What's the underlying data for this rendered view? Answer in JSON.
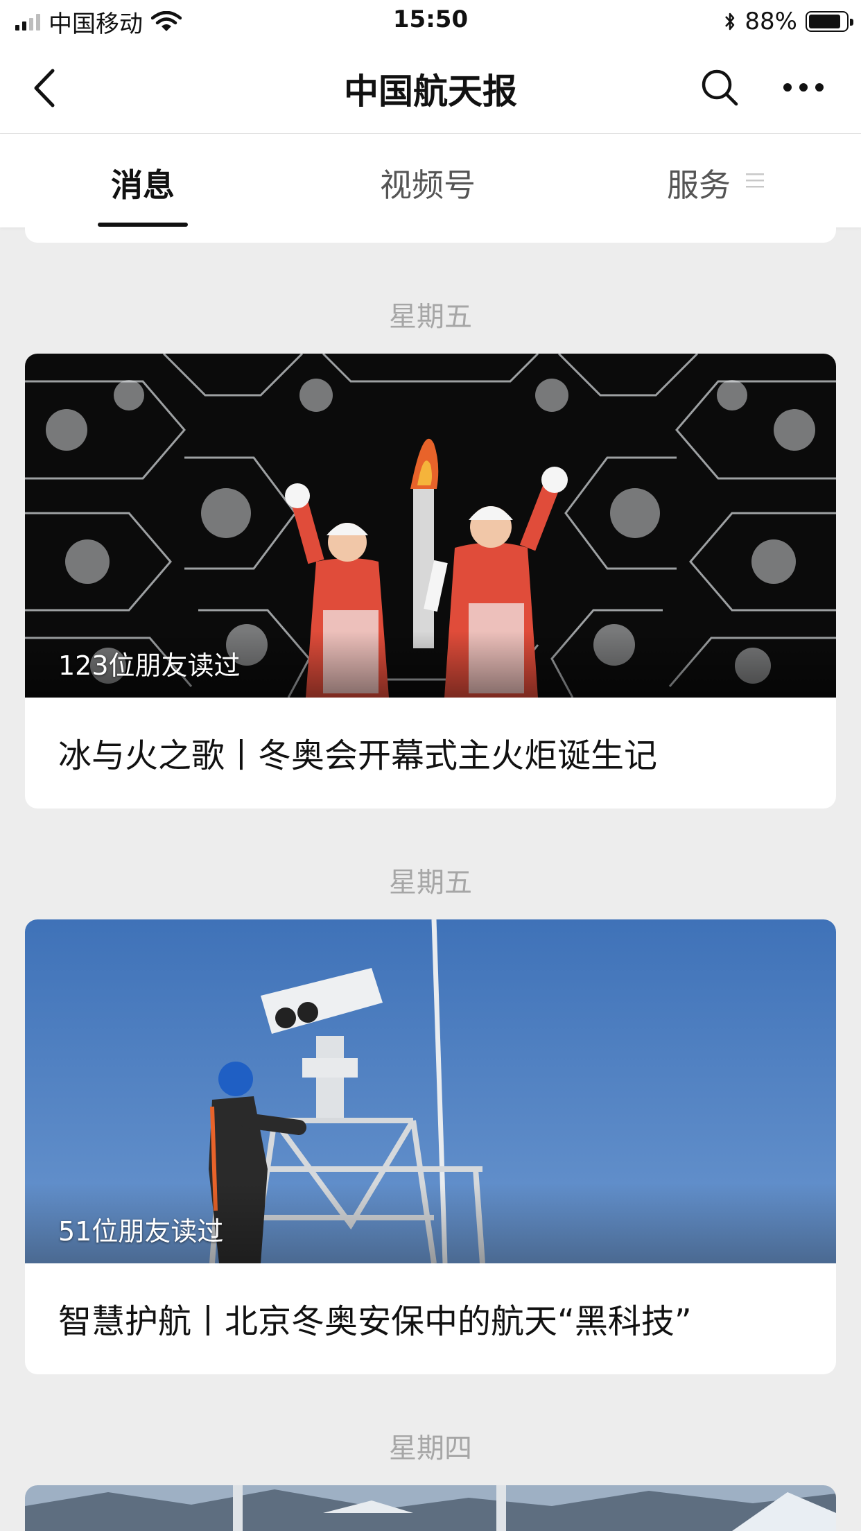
{
  "status_bar": {
    "carrier": "中国移动",
    "time": "15:50",
    "battery_percent": "88%",
    "battery_level": 0.88
  },
  "nav": {
    "title": "中国航天报"
  },
  "tabs": [
    {
      "label": "消息",
      "active": true
    },
    {
      "label": "视频号",
      "active": false
    },
    {
      "label": "服务",
      "active": false
    }
  ],
  "feed": [
    {
      "day": "星期五",
      "readers": "123位朋友读过",
      "title": "冰与火之歌丨冬奥会开幕式主火炬诞生记"
    },
    {
      "day": "星期五",
      "readers": "51位朋友读过",
      "title": "智慧护航丨北京冬奥安保中的航天“黑科技”"
    },
    {
      "day": "星期四"
    }
  ],
  "colors": {
    "background": "#ededed",
    "card": "#ffffff",
    "muted_text": "#a6a6a6",
    "sky_blue": "#4a7fc0"
  }
}
